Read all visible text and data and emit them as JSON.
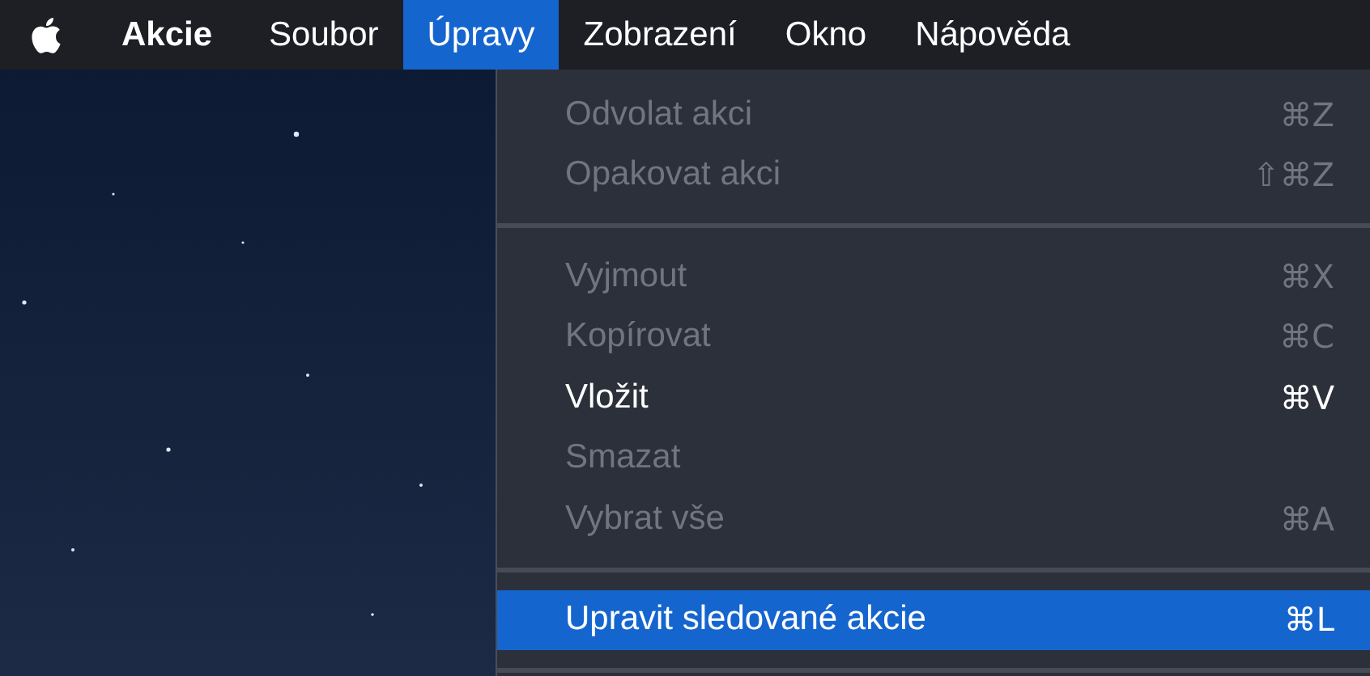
{
  "menu_bar": {
    "items": [
      {
        "label": "Akcie",
        "kind": "app",
        "selected": false
      },
      {
        "label": "Soubor",
        "kind": "menu",
        "selected": false
      },
      {
        "label": "Úpravy",
        "kind": "menu",
        "selected": true
      },
      {
        "label": "Zobrazení",
        "kind": "menu",
        "selected": false
      },
      {
        "label": "Okno",
        "kind": "menu",
        "selected": false
      },
      {
        "label": "Nápověda",
        "kind": "menu",
        "selected": false
      }
    ]
  },
  "dropdown": {
    "items": [
      {
        "kind": "item",
        "label": "Odvolat akci",
        "shortcut": "⌘Z",
        "disabled": true,
        "selected": false
      },
      {
        "kind": "item",
        "label": "Opakovat akci",
        "shortcut": "⇧⌘Z",
        "disabled": true,
        "selected": false
      },
      {
        "kind": "separator"
      },
      {
        "kind": "item",
        "label": "Vyjmout",
        "shortcut": "⌘X",
        "disabled": true,
        "selected": false
      },
      {
        "kind": "item",
        "label": "Kopírovat",
        "shortcut": "⌘C",
        "disabled": true,
        "selected": false
      },
      {
        "kind": "item",
        "label": "Vložit",
        "shortcut": "⌘V",
        "disabled": false,
        "selected": false
      },
      {
        "kind": "item",
        "label": "Smazat",
        "disabled": true,
        "selected": false
      },
      {
        "kind": "item",
        "label": "Vybrat vše",
        "shortcut": "⌘A",
        "disabled": true,
        "selected": false
      },
      {
        "kind": "separator"
      },
      {
        "kind": "item",
        "label": "Upravit sledované akcie",
        "shortcut": "⌘L",
        "disabled": false,
        "selected": true
      },
      {
        "kind": "separator"
      }
    ]
  }
}
